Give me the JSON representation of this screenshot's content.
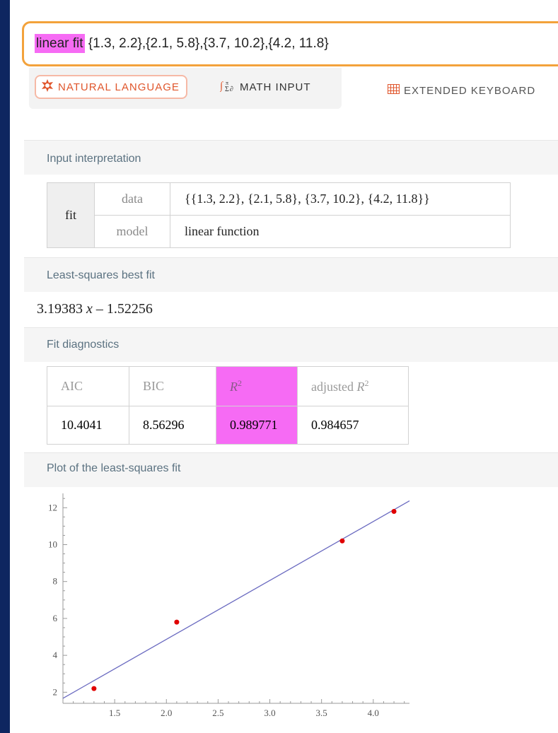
{
  "search": {
    "query_highlight": "linear fit",
    "query_rest": " {1.3, 2.2},{2.1, 5.8},{3.7, 10.2},{4.2, 11.8}"
  },
  "modes": {
    "natural_language": "NATURAL LANGUAGE",
    "math_input": "MATH INPUT",
    "extended_keyboard": "EXTENDED KEYBOARD",
    "natural_language_icon": "wolfram-star-icon",
    "math_input_icon": "math-sum-icon",
    "extended_keyboard_icon": "keyboard-grid-icon"
  },
  "pods": {
    "interpretation": {
      "title": "Input interpretation",
      "fit_label": "fit",
      "rows": [
        {
          "key": "data",
          "value": "{{1.3, 2.2}, {2.1, 5.8}, {3.7, 10.2}, {4.2, 11.8}}"
        },
        {
          "key": "model",
          "value": "linear function"
        }
      ]
    },
    "best_fit": {
      "title": "Least-squares best fit",
      "coef": "3.19383",
      "var": "x",
      "rest": " – 1.52256"
    },
    "diagnostics": {
      "title": "Fit diagnostics",
      "headers": {
        "aic": "AIC",
        "bic": "BIC",
        "r2_base": "R",
        "r2_sup": "2",
        "adj_base": "adjusted ",
        "adj_r": "R",
        "adj_sup": "2"
      },
      "values": {
        "aic": "10.4041",
        "bic": "8.56296",
        "r2": "0.989771",
        "adj": "0.984657"
      }
    },
    "plot": {
      "title": "Plot of the least-squares fit"
    }
  },
  "colors": {
    "highlight": "#f66bf4",
    "search_border": "#f3a23b",
    "accent": "#e0562c",
    "fit_line": "#6a6ac0",
    "points": "#e00000"
  },
  "chart_data": {
    "type": "scatter",
    "title": "",
    "xlabel": "",
    "ylabel": "",
    "xlim": [
      1.0,
      4.35
    ],
    "ylim": [
      1.4,
      12.7
    ],
    "xticks": [
      "1.5",
      "2.0",
      "2.5",
      "3.0",
      "3.5",
      "4.0"
    ],
    "yticks": [
      "2",
      "4",
      "6",
      "8",
      "10",
      "12"
    ],
    "series": [
      {
        "type": "scatter",
        "x": [
          1.3,
          2.1,
          3.7,
          4.2
        ],
        "y": [
          2.2,
          5.8,
          10.2,
          11.8
        ]
      },
      {
        "type": "line",
        "slope": 3.19383,
        "intercept": -1.52256
      }
    ],
    "grid": false
  }
}
